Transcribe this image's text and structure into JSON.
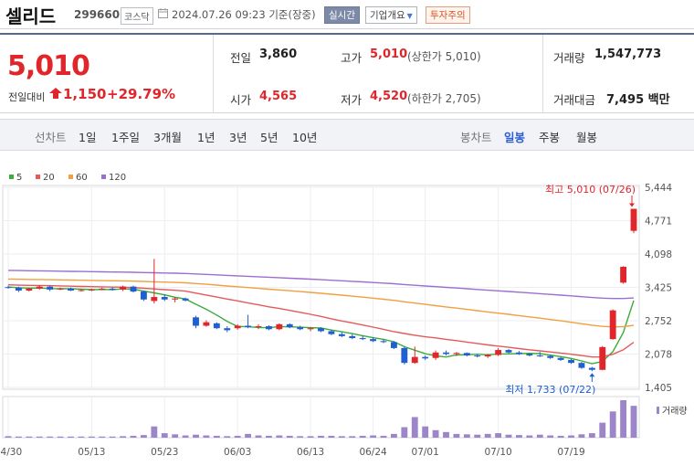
{
  "header": {
    "name": "셀리드",
    "code": "299660",
    "market": "코스닥",
    "datetime": "2024.07.26 09:23",
    "status": "기준(장중)",
    "realtime_label": "실시간",
    "company_label": "기업개요",
    "warning_label": "투자주의"
  },
  "price": {
    "current": "5,010",
    "change_label": "전일대비",
    "change": "1,150",
    "change_pct": "+29.79%",
    "colors": {
      "up": "#e0262a",
      "down": "#1f5fd1"
    }
  },
  "stats": {
    "prev_label": "전일",
    "prev": "3,860",
    "high_label": "고가",
    "high": "5,010",
    "upper_limit": "(상한가 5,010)",
    "volume_label": "거래량",
    "volume": "1,547,773",
    "open_label": "시가",
    "open": "4,565",
    "low_label": "저가",
    "low": "4,520",
    "lower_limit": "(하한가 2,705)",
    "amount_label": "거래대금",
    "amount": "7,495",
    "amount_unit": "백만"
  },
  "periods": {
    "line_label": "선차트",
    "line_items": [
      "1일",
      "1주일",
      "3개월",
      "1년",
      "3년",
      "5년",
      "10년"
    ],
    "candle_label": "봉차트",
    "candle_items": [
      "일봉",
      "주봉",
      "월봉"
    ],
    "candle_active": "일봉"
  },
  "chart_data": {
    "type": "candlestick",
    "legend": [
      {
        "name": "5",
        "color": "#3aad3a"
      },
      {
        "name": "20",
        "color": "#e45a5a"
      },
      {
        "name": "60",
        "color": "#f0a040"
      },
      {
        "name": "120",
        "color": "#9b6fd1"
      }
    ],
    "y_ticks": [
      5444,
      4771,
      4098,
      3425,
      2752,
      2078,
      1405
    ],
    "y_tick_labels": [
      "5,444",
      "4,771",
      "4,098",
      "3,425",
      "2,752",
      "2,078",
      "1,405"
    ],
    "ylim": [
      1405,
      5444
    ],
    "x_tick_labels": [
      {
        "label": "04/30",
        "index": 0
      },
      {
        "label": "05/13",
        "index": 8
      },
      {
        "label": "05/23",
        "index": 15
      },
      {
        "label": "06/03",
        "index": 22
      },
      {
        "label": "06/13",
        "index": 29
      },
      {
        "label": "06/24",
        "index": 35
      },
      {
        "label": "07/01",
        "index": 40
      },
      {
        "label": "07/10",
        "index": 47
      },
      {
        "label": "07/19",
        "index": 54
      }
    ],
    "high_annotation": "최고 5,010 (07/26)",
    "low_annotation": "최저 1,733 (07/22)",
    "volume_label": "거래량",
    "candles": [
      [
        3430,
        3460,
        3400,
        3420
      ],
      [
        3420,
        3440,
        3330,
        3360
      ],
      [
        3360,
        3420,
        3340,
        3400
      ],
      [
        3400,
        3470,
        3380,
        3440
      ],
      [
        3440,
        3460,
        3350,
        3380
      ],
      [
        3380,
        3420,
        3370,
        3400
      ],
      [
        3400,
        3420,
        3350,
        3360
      ],
      [
        3360,
        3390,
        3340,
        3370
      ],
      [
        3370,
        3400,
        3350,
        3380
      ],
      [
        3380,
        3420,
        3370,
        3400
      ],
      [
        3400,
        3430,
        3360,
        3380
      ],
      [
        3380,
        3460,
        3350,
        3440
      ],
      [
        3440,
        3460,
        3320,
        3340
      ],
      [
        3340,
        3360,
        3150,
        3180
      ],
      [
        3150,
        4000,
        3100,
        3230
      ],
      [
        3230,
        3280,
        3150,
        3180
      ],
      [
        3180,
        3230,
        3120,
        3200
      ],
      [
        3200,
        3220,
        3140,
        3160
      ],
      [
        2820,
        2850,
        2600,
        2650
      ],
      [
        2650,
        2760,
        2630,
        2720
      ],
      [
        2700,
        2720,
        2580,
        2600
      ],
      [
        2600,
        2640,
        2520,
        2560
      ],
      [
        2600,
        2680,
        2570,
        2650
      ],
      [
        2650,
        2870,
        2600,
        2620
      ],
      [
        2620,
        2680,
        2580,
        2640
      ],
      [
        2640,
        2660,
        2560,
        2580
      ],
      [
        2580,
        2700,
        2560,
        2680
      ],
      [
        2680,
        2700,
        2600,
        2620
      ],
      [
        2620,
        2650,
        2560,
        2580
      ],
      [
        2580,
        2620,
        2540,
        2600
      ],
      [
        2600,
        2620,
        2520,
        2540
      ],
      [
        2540,
        2570,
        2460,
        2480
      ],
      [
        2480,
        2520,
        2420,
        2440
      ],
      [
        2440,
        2480,
        2380,
        2400
      ],
      [
        2400,
        2450,
        2360,
        2380
      ],
      [
        2380,
        2420,
        2320,
        2340
      ],
      [
        2340,
        2380,
        2300,
        2320
      ],
      [
        2320,
        2340,
        2180,
        2200
      ],
      [
        2200,
        2220,
        1870,
        1900
      ],
      [
        1900,
        2230,
        1880,
        2020
      ],
      [
        2020,
        2050,
        1960,
        1990
      ],
      [
        2000,
        2150,
        1960,
        2110
      ],
      [
        2110,
        2150,
        2050,
        2080
      ],
      [
        2080,
        2120,
        2040,
        2100
      ],
      [
        2100,
        2110,
        2030,
        2050
      ],
      [
        2050,
        2080,
        2010,
        2030
      ],
      [
        2030,
        2080,
        2000,
        2060
      ],
      [
        2060,
        2200,
        2040,
        2160
      ],
      [
        2160,
        2180,
        2090,
        2110
      ],
      [
        2110,
        2140,
        2060,
        2080
      ],
      [
        2080,
        2100,
        2030,
        2050
      ],
      [
        2050,
        2120,
        2020,
        2040
      ],
      [
        2040,
        2060,
        1980,
        2000
      ],
      [
        2000,
        2020,
        1940,
        1960
      ],
      [
        1960,
        1980,
        1880,
        1900
      ],
      [
        1900,
        1920,
        1780,
        1800
      ],
      [
        1800,
        1820,
        1733,
        1760
      ],
      [
        1760,
        2240,
        1750,
        2220
      ],
      [
        2380,
        2980,
        2370,
        2960
      ],
      [
        3520,
        3850,
        3500,
        3840
      ],
      [
        4565,
        5010,
        4520,
        5010
      ]
    ],
    "volume": [
      4,
      3,
      3,
      3,
      3,
      3,
      3,
      3,
      3,
      3,
      3,
      4,
      5,
      7,
      30,
      12,
      9,
      6,
      8,
      6,
      5,
      4,
      5,
      10,
      6,
      5,
      6,
      5,
      4,
      4,
      5,
      5,
      4,
      4,
      5,
      6,
      5,
      10,
      28,
      55,
      30,
      20,
      15,
      10,
      9,
      8,
      10,
      12,
      8,
      7,
      6,
      8,
      6,
      5,
      6,
      9,
      12,
      40,
      70,
      100,
      85
    ]
  }
}
